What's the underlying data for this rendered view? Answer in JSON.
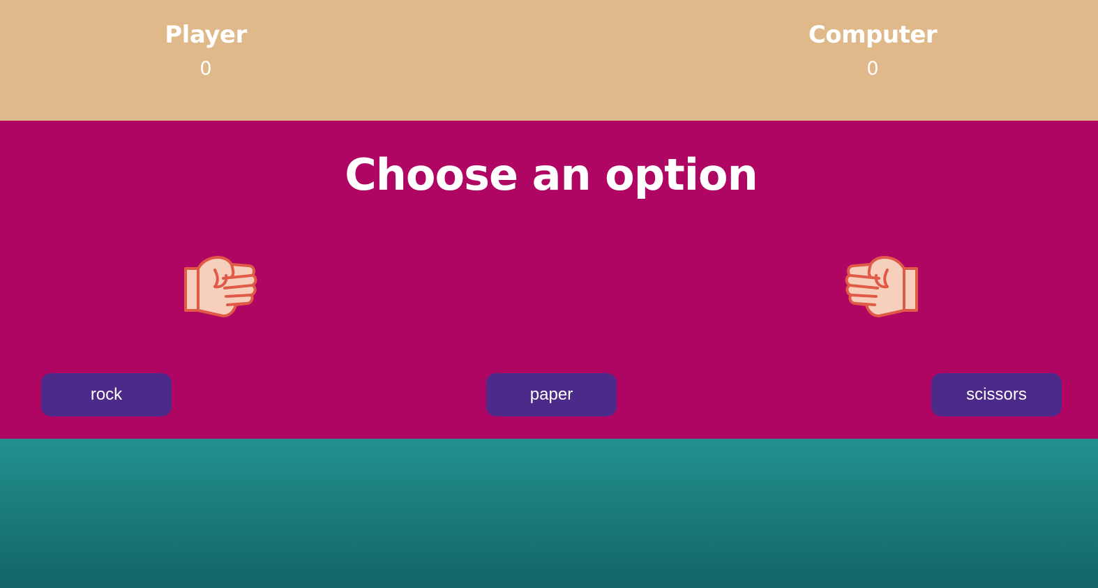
{
  "scoreboard": {
    "player": {
      "label": "Player",
      "score": "0"
    },
    "computer": {
      "label": "Computer",
      "score": "0"
    }
  },
  "arena": {
    "prompt": "Choose an option",
    "player_hand_icon": "fist-icon",
    "computer_hand_icon": "fist-icon",
    "choices": [
      {
        "label": "rock"
      },
      {
        "label": "paper"
      },
      {
        "label": "scissors"
      }
    ]
  },
  "colors": {
    "scoreboard_bg": "#e0b98a",
    "arena_bg": "#b00663",
    "button_bg": "#4b2a8a",
    "footer_top": "#23918f",
    "footer_bottom": "#136466",
    "hand_fill": "#f7cfbd",
    "hand_outline": "#e05a48"
  }
}
